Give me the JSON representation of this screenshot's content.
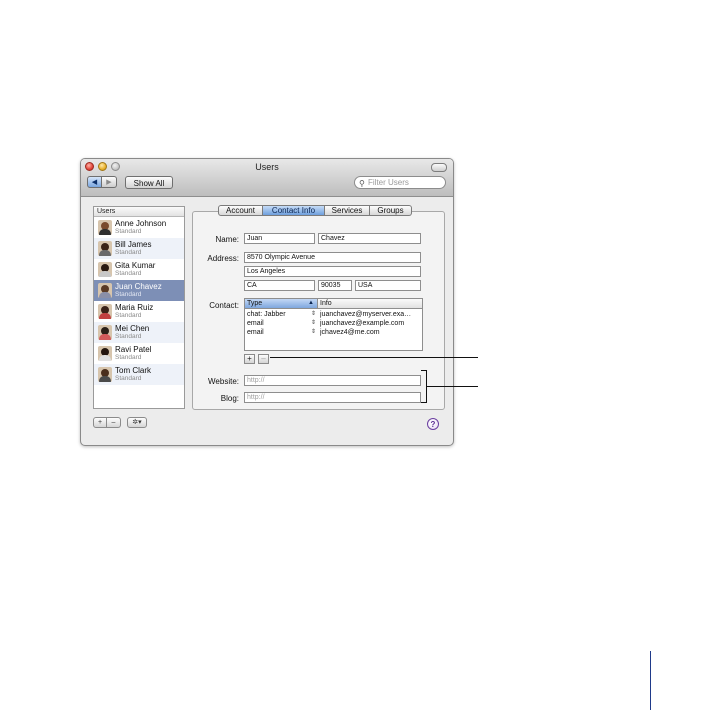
{
  "window": {
    "title": "Users",
    "show_all_label": "Show All",
    "search_placeholder": "Filter Users",
    "nav_back": "◀",
    "nav_forward": "▶"
  },
  "users": {
    "header": "Users",
    "items": [
      {
        "name": "Anne Johnson",
        "role": "Standard"
      },
      {
        "name": "Bill James",
        "role": "Standard"
      },
      {
        "name": "Gita Kumar",
        "role": "Standard"
      },
      {
        "name": "Juan Chavez",
        "role": "Standard"
      },
      {
        "name": "Maria Ruiz",
        "role": "Standard"
      },
      {
        "name": "Mei Chen",
        "role": "Standard"
      },
      {
        "name": "Ravi Patel",
        "role": "Standard"
      },
      {
        "name": "Tom Clark",
        "role": "Standard"
      }
    ]
  },
  "tabs": [
    {
      "label": "Account"
    },
    {
      "label": "Contact Info"
    },
    {
      "label": "Services"
    },
    {
      "label": "Groups"
    }
  ],
  "form": {
    "name_label": "Name:",
    "first_name": "Juan",
    "last_name": "Chavez",
    "address_label": "Address:",
    "street": "8570 Olympic Avenue",
    "city": "Los Angeles",
    "state": "CA",
    "zip": "90035",
    "country": "USA",
    "contact_label": "Contact:",
    "website_label": "Website:",
    "website_placeholder": "http://",
    "blog_label": "Blog:",
    "blog_placeholder": "http://"
  },
  "contact_table": {
    "col_type": "Type",
    "col_info": "Info",
    "rows": [
      {
        "type": "chat: Jabber",
        "info": "juanchavez@myserver.exa…"
      },
      {
        "type": "email",
        "info": "juanchavez@example.com"
      },
      {
        "type": "email",
        "info": "jchavez4@me.com"
      }
    ],
    "add_label": "+",
    "remove_label": "–"
  },
  "bottom": {
    "add_label": "+",
    "remove_label": "–",
    "action_label": "✲▾",
    "help_label": "?"
  },
  "colors": {
    "selection": "#7d8fb6",
    "active_tab": "#6e9fdc",
    "help": "#6b3fa0",
    "page_rule": "#1f3a8a"
  }
}
